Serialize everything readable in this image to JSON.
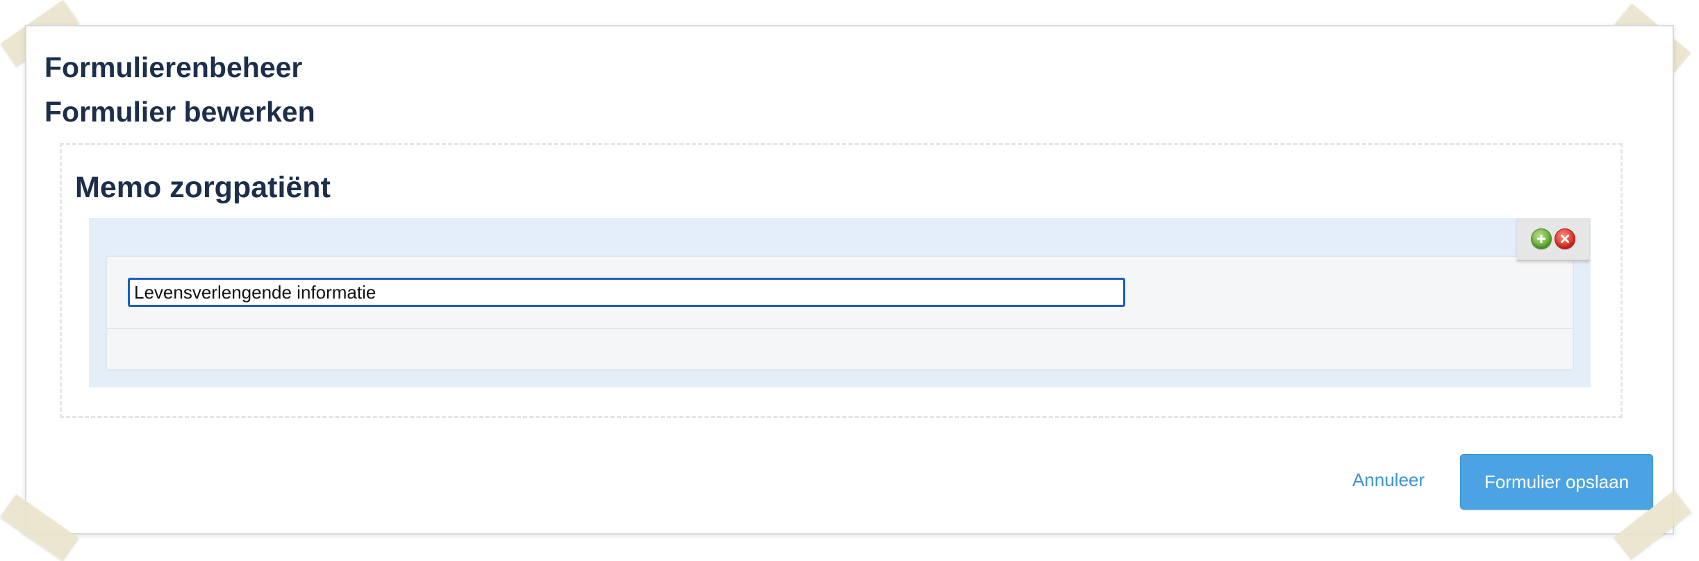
{
  "header": {
    "app_title": "Formulierenbeheer",
    "page_title": "Formulier bewerken"
  },
  "form": {
    "title": "Memo zorgpatiënt",
    "section": {
      "toolbar": {
        "add_icon": "add-circle-icon",
        "remove_icon": "remove-circle-icon"
      },
      "field": {
        "value": "Levensverlengende informatie"
      }
    }
  },
  "actions": {
    "cancel_label": "Annuleer",
    "save_label": "Formulier opslaan"
  },
  "colors": {
    "heading": "#1d2e4b",
    "accent": "#4ba3e3",
    "link": "#3a94d6",
    "section_bg": "#e3eef8",
    "input_border": "#1f5bc6"
  }
}
